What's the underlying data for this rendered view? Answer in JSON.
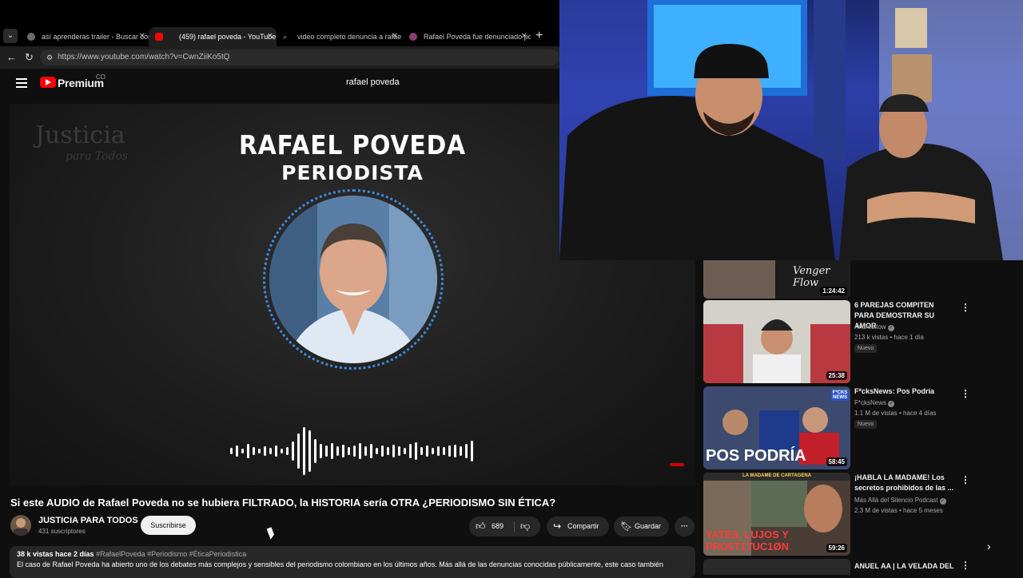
{
  "browser": {
    "tabs": [
      {
        "title": "así aprenderas trailer - Buscar con",
        "active": false
      },
      {
        "title": "(459) rafael poveda - YouTube",
        "active": true
      },
      {
        "title": "video completo denuncia a rafael",
        "active": false
      },
      {
        "title": "Rafael Poveda fue denunciado po",
        "active": false
      }
    ],
    "url": "https://www.youtube.com/watch?v=CwnZiiKo5tQ"
  },
  "header": {
    "brand": "Premium",
    "brand_sup": "CO",
    "search_query": "rafael poveda"
  },
  "player": {
    "watermark_line1": "Justicia",
    "watermark_line2": "para Todos",
    "headline": "RAFAEL POVEDA",
    "subheadline": "PERIODISTA"
  },
  "video": {
    "title": "Si este AUDIO de Rafael Poveda no se hubiera FILTRADO, la HISTORIA sería OTRA ¿PERIODISMO SIN ÉTICA?",
    "channel": "JUSTICIA PARA TODOS",
    "subscribers": "431 suscriptores",
    "subscribe_label": "Suscribirse",
    "likes": "689",
    "share_label": "Compartir",
    "save_label": "Guardar",
    "views_date": "38 k vistas  hace 2 días",
    "hashtags": "#RafaelPoveda #Periodismo #ÉticaPeriodistica",
    "description": "El caso de Rafael Poveda ha abierto uno de los debates más complejos y sensibles del periodismo colombiano en los últimos años. Más allá de las denuncias conocidas públicamente, este caso también"
  },
  "sidebar": {
    "items": [
      {
        "duration": "1:24:42",
        "thumb_text": "Venger Flow"
      },
      {
        "title": "6 PAREJAS COMPITEN PARA DEMOSTRAR SU AMOR",
        "channel": "Andresitow",
        "meta": "213 k vistas • hace 1 día",
        "badge": "Nuevo",
        "duration": "25:38"
      },
      {
        "title": "F*cksNews: Pos Podría",
        "channel": "F*cksNews",
        "meta": "1.1 M de vistas • hace 4 días",
        "badge": "Nuevo",
        "duration": "58:45",
        "thumb_text": "POS PODRÍA",
        "thumb_logo": "F*CKS NEWS"
      },
      {
        "title": "¡HABLA LA MADAME! Los secretos prohibidos de las ...",
        "channel": "Más Allá del Silencio Podcast",
        "meta": "2.3 M de vistas • hace 5 meses",
        "duration": "59:26",
        "thumb_text": "YATES, LUJOS Y PRO5T1TUC1ØN",
        "thumb_top": "LA MADAME DE CARTAGENA"
      },
      {
        "title": "ANUEL AA | LA VELADA DEL"
      }
    ]
  },
  "colors": {
    "accent": "#ff0000",
    "ring": "#3d8be0",
    "background": "#0f0f0f"
  }
}
